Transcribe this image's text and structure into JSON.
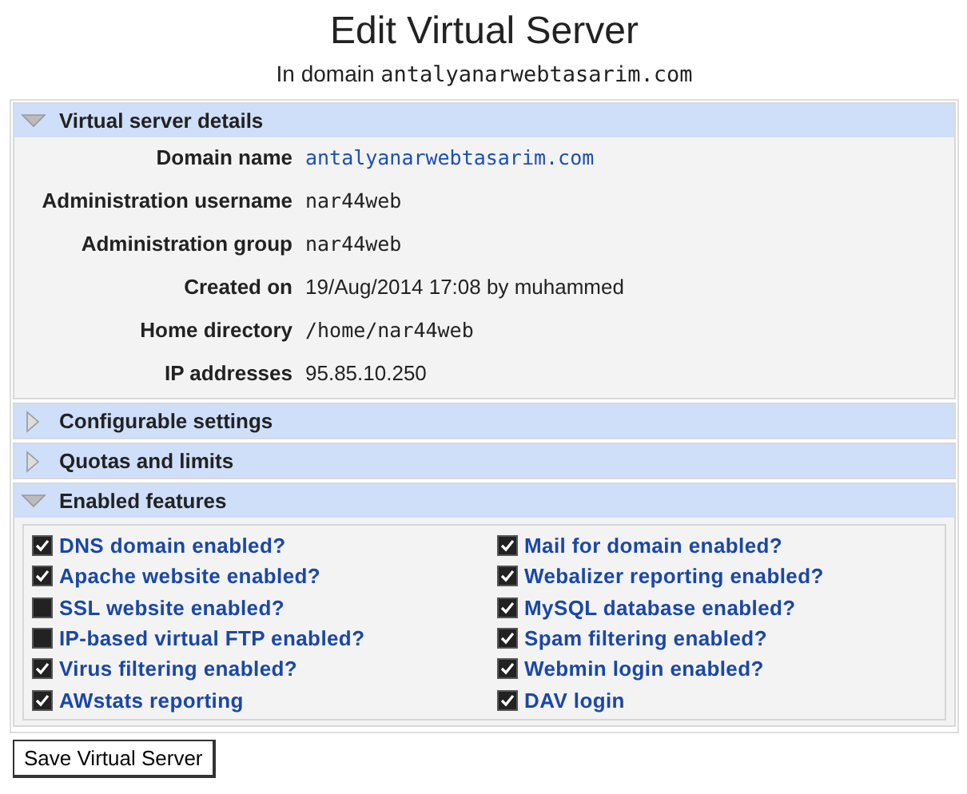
{
  "title": "Edit Virtual Server",
  "subtitle": {
    "prefix": "In domain",
    "domain": "antalyanarwebtasarim.com"
  },
  "sections": [
    {
      "title": "Virtual server details",
      "expanded": true,
      "kind": "details",
      "rows": [
        {
          "label": "Domain name",
          "value": "antalyanarwebtasarim.com",
          "kind": "link"
        },
        {
          "label": "Administration username",
          "value": "nar44web",
          "kind": "mono"
        },
        {
          "label": "Administration group",
          "value": "nar44web",
          "kind": "mono"
        },
        {
          "label": "Created on",
          "value": "19/Aug/2014 17:08 by muhammed",
          "kind": "text"
        },
        {
          "label": "Home directory",
          "value": "/home/nar44web",
          "kind": "mono"
        },
        {
          "label": "IP addresses",
          "value": "95.85.10.250",
          "kind": "text"
        }
      ]
    },
    {
      "title": "Configurable settings",
      "expanded": false
    },
    {
      "title": "Quotas and limits",
      "expanded": false
    },
    {
      "title": "Enabled features",
      "expanded": true,
      "kind": "features",
      "features": [
        {
          "label": "DNS domain enabled?",
          "checked": true
        },
        {
          "label": "Mail for domain enabled?",
          "checked": true
        },
        {
          "label": "Apache website enabled?",
          "checked": true
        },
        {
          "label": "Webalizer reporting enabled?",
          "checked": true
        },
        {
          "label": "SSL website enabled?",
          "checked": false
        },
        {
          "label": "MySQL database enabled?",
          "checked": true
        },
        {
          "label": "IP-based virtual FTP enabled?",
          "checked": false
        },
        {
          "label": "Spam filtering enabled?",
          "checked": true
        },
        {
          "label": "Virus filtering enabled?",
          "checked": true
        },
        {
          "label": "Webmin login enabled?",
          "checked": true
        },
        {
          "label": "AWstats reporting",
          "checked": true
        },
        {
          "label": "DAV login",
          "checked": true
        }
      ]
    }
  ],
  "save_button": "Save Virtual Server"
}
